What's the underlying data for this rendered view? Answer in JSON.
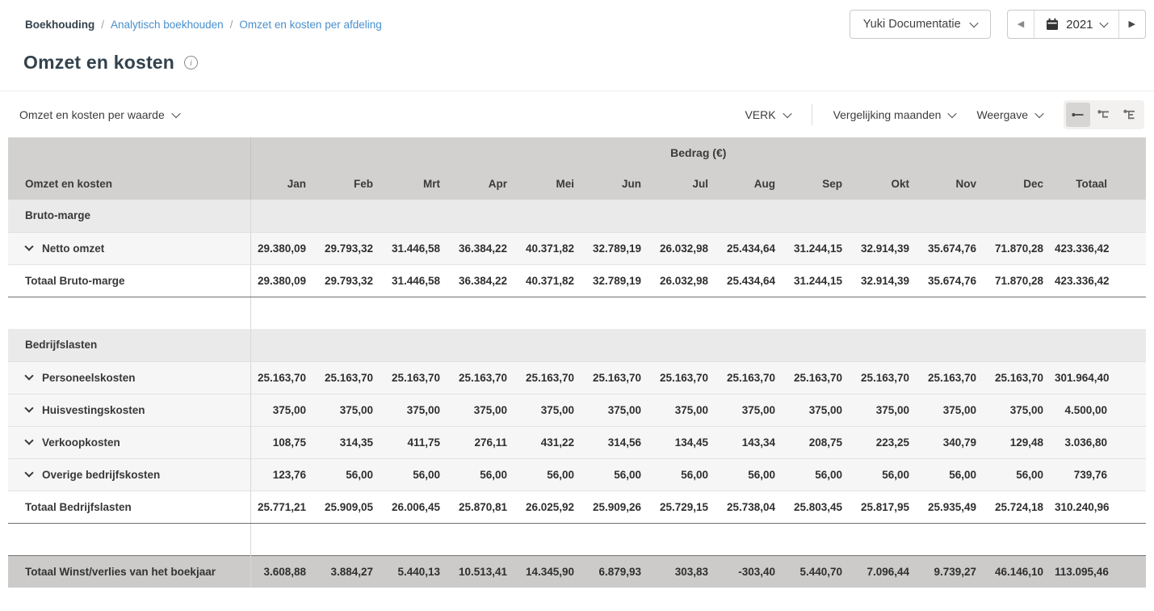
{
  "colors": {
    "link": "#4a8fcc",
    "title_text": "#33424d",
    "header_bg": "#d2d1d0",
    "section_bg": "#ebeaea",
    "detail_bg": "#f7f6f6",
    "grand_total_bg": "#cccbca"
  },
  "breadcrumb": {
    "separator": "/",
    "items": [
      {
        "label": "Boekhouding"
      },
      {
        "label": "Analytisch boekhouden"
      },
      {
        "label": "Omzet en kosten per afdeling"
      }
    ]
  },
  "header": {
    "administration_dropdown": "Yuki Documentatie",
    "year": "2021",
    "title": "Omzet en kosten"
  },
  "icons": {
    "info": "i",
    "calendar": "calendar-icon",
    "prev_arrow": "◀",
    "next_arrow": "▶",
    "view_levels": [
      "expand-level-1-icon",
      "expand-level-2-icon",
      "expand-level-3-icon"
    ]
  },
  "toolbar": {
    "report_dropdown": "Omzet en kosten per waarde",
    "verk_dropdown": "VERK",
    "comparison_dropdown": "Vergelijking maanden",
    "view_dropdown": "Weergave"
  },
  "table": {
    "group_header": "Bedrag (€)",
    "label_header": "Omzet en kosten",
    "columns": [
      "Jan",
      "Feb",
      "Mrt",
      "Apr",
      "Mei",
      "Jun",
      "Jul",
      "Aug",
      "Sep",
      "Okt",
      "Nov",
      "Dec",
      "Totaal"
    ],
    "rows": [
      {
        "type": "section",
        "label": "Bruto-marge",
        "values": []
      },
      {
        "type": "detail",
        "label": "Netto omzet",
        "values": [
          "29.380,09",
          "29.793,32",
          "31.446,58",
          "36.384,22",
          "40.371,82",
          "32.789,19",
          "26.032,98",
          "25.434,64",
          "31.244,15",
          "32.914,39",
          "35.674,76",
          "71.870,28",
          "423.336,42"
        ]
      },
      {
        "type": "total",
        "label": "Totaal Bruto-marge",
        "values": [
          "29.380,09",
          "29.793,32",
          "31.446,58",
          "36.384,22",
          "40.371,82",
          "32.789,19",
          "26.032,98",
          "25.434,64",
          "31.244,15",
          "32.914,39",
          "35.674,76",
          "71.870,28",
          "423.336,42"
        ]
      },
      {
        "type": "spacer",
        "label": "",
        "values": []
      },
      {
        "type": "section",
        "label": "Bedrijfslasten",
        "values": []
      },
      {
        "type": "detail",
        "label": "Personeelskosten",
        "values": [
          "25.163,70",
          "25.163,70",
          "25.163,70",
          "25.163,70",
          "25.163,70",
          "25.163,70",
          "25.163,70",
          "25.163,70",
          "25.163,70",
          "25.163,70",
          "25.163,70",
          "25.163,70",
          "301.964,40"
        ]
      },
      {
        "type": "detail",
        "label": "Huisvestingskosten",
        "values": [
          "375,00",
          "375,00",
          "375,00",
          "375,00",
          "375,00",
          "375,00",
          "375,00",
          "375,00",
          "375,00",
          "375,00",
          "375,00",
          "375,00",
          "4.500,00"
        ]
      },
      {
        "type": "detail",
        "label": "Verkoopkosten",
        "values": [
          "108,75",
          "314,35",
          "411,75",
          "276,11",
          "431,22",
          "314,56",
          "134,45",
          "143,34",
          "208,75",
          "223,25",
          "340,79",
          "129,48",
          "3.036,80"
        ]
      },
      {
        "type": "detail",
        "label": "Overige bedrijfskosten",
        "values": [
          "123,76",
          "56,00",
          "56,00",
          "56,00",
          "56,00",
          "56,00",
          "56,00",
          "56,00",
          "56,00",
          "56,00",
          "56,00",
          "56,00",
          "739,76"
        ]
      },
      {
        "type": "total",
        "label": "Totaal Bedrijfslasten",
        "values": [
          "25.771,21",
          "25.909,05",
          "26.006,45",
          "25.870,81",
          "26.025,92",
          "25.909,26",
          "25.729,15",
          "25.738,04",
          "25.803,45",
          "25.817,95",
          "25.935,49",
          "25.724,18",
          "310.240,96"
        ]
      },
      {
        "type": "spacer",
        "label": "",
        "values": []
      },
      {
        "type": "grand",
        "label": "Totaal Winst/verlies van het boekjaar",
        "values": [
          "3.608,88",
          "3.884,27",
          "5.440,13",
          "10.513,41",
          "14.345,90",
          "6.879,93",
          "303,83",
          "-303,40",
          "5.440,70",
          "7.096,44",
          "9.739,27",
          "46.146,10",
          "113.095,46"
        ]
      }
    ]
  }
}
